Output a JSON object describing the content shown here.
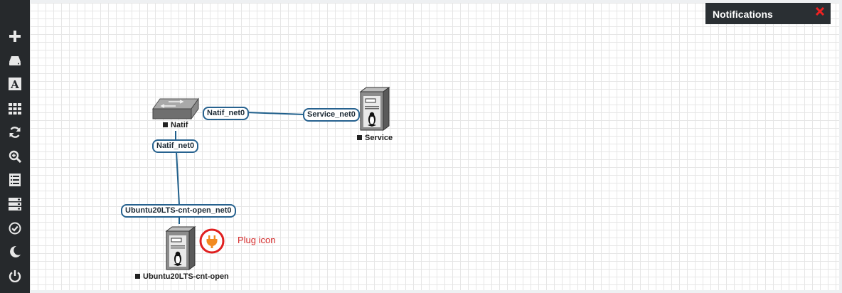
{
  "sidebar": {
    "items": [
      {
        "name": "add-icon",
        "label": "Add an object"
      },
      {
        "name": "storage-icon",
        "label": "Nodes"
      },
      {
        "name": "text-icon",
        "label": "Text"
      },
      {
        "name": "grid-icon",
        "label": "Arrange"
      },
      {
        "name": "refresh-icon",
        "label": "Refresh"
      },
      {
        "name": "zoom-icon",
        "label": "Zoom"
      },
      {
        "name": "list-icon",
        "label": "Logs"
      },
      {
        "name": "server-list-icon",
        "label": "Status"
      },
      {
        "name": "check-circle-icon",
        "label": "Validate"
      },
      {
        "name": "moon-icon",
        "label": "Dark mode"
      },
      {
        "name": "power-icon",
        "label": "Power"
      }
    ]
  },
  "notifications": {
    "title": "Notifications",
    "close_icon": "close-icon"
  },
  "topology": {
    "nodes": {
      "natif": {
        "label": "Natif",
        "icon": "switch-icon"
      },
      "service": {
        "label": "Service",
        "icon": "linux-server-icon"
      },
      "ubuntu": {
        "label": "Ubuntu20LTS-cnt-open",
        "icon": "linux-server-icon"
      }
    },
    "interfaces": {
      "natif_to_service": "Natif_net0",
      "service": "Service_net0",
      "natif_to_ubuntu": "Natif_net0",
      "ubuntu": "Ubuntu20LTS-cnt-open_net0"
    },
    "link_color": "#1f5f8b"
  },
  "annotation": {
    "text": "Plug icon",
    "color": "#d52a2a",
    "icon": "plug-icon"
  }
}
